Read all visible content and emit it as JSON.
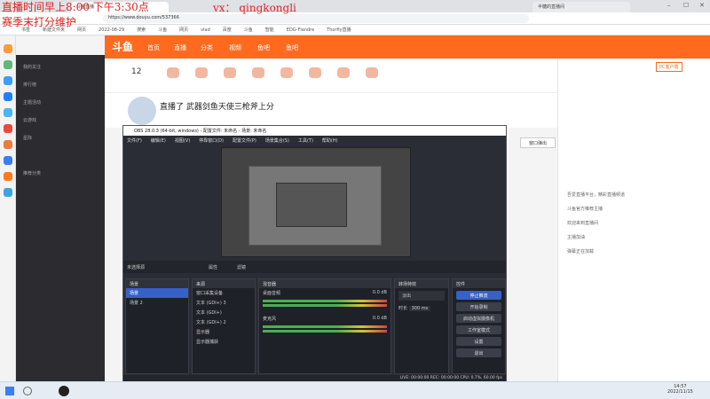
{
  "overlay": {
    "line1": "直播时间早上8:00 下午3:30点",
    "line2": "赛季末打分维护",
    "vx": "vx： qingkongli"
  },
  "browser": {
    "url": "https://www.douyu.com/537366",
    "tabs": [
      "斗鱼直播",
      "半糖的直播间"
    ],
    "bookmarks": [
      "书签",
      "新建文件夹",
      "网页",
      "2022-08-29",
      "搜索",
      "斗鱼",
      "网页",
      "vlad",
      "百度",
      "斗鱼",
      "智能",
      "EDG-Flandre",
      "Thorfly直播"
    ]
  },
  "douyu": {
    "logo": "斗鱼",
    "nav": [
      "首页",
      "直播",
      "分类",
      "视频",
      "鱼吧",
      "鱼吧"
    ],
    "sidebar": [
      "我的关注",
      "排行榜",
      "主题活动",
      "云游戏",
      "星际",
      "推荐分类"
    ],
    "follow_count": "12",
    "room_title": "直播了 武器剑鱼天使三枪斧上分",
    "chat": [
      "吾爱直播平台，精彩直播频道",
      "斗鱼官方推荐主播",
      "欢迎来到直播间",
      "主播加油",
      "弹幕正在加载"
    ],
    "float_button": "窗口弹出",
    "pc_badge": "PC客户端"
  },
  "obs": {
    "title": "OBS 28.0.3 (64-bit, windows) - 配置文件: 未命名 - 场景: 未命名",
    "menu": [
      "文件(F)",
      "编辑(E)",
      "视图(V)",
      "停靠窗口(D)",
      "配置文件(P)",
      "场景集合(S)",
      "工具(T)",
      "帮助(H)"
    ],
    "no_source": "未选择源",
    "props": "属性",
    "filters": "滤镜",
    "scenes_hdr": "场景",
    "scenes": [
      "场景",
      "场景 2"
    ],
    "sources_hdr": "来源",
    "sources": [
      "窗口采集设备",
      "文本 (GDI+) 3",
      "文本 (GDI+)",
      "文本 (GDI+) 2",
      "显示器",
      "显示器捕获"
    ],
    "mixer_hdr": "混音器",
    "mixer": [
      {
        "name": "桌面音频",
        "db": "0.0 dB"
      },
      {
        "name": "麦克风",
        "db": "0.0 dB"
      }
    ],
    "transition_hdr": "转场特效",
    "transition_value": "淡出",
    "duration_label": "时长",
    "duration_value": "300 ms",
    "controls_hdr": "控件",
    "controls": [
      "停止推流",
      "开始录制",
      "启动虚拟摄像机",
      "工作室模式",
      "设置",
      "退出"
    ],
    "status": "LIVE: 00:00:00   REC: 00:00:00   CPU: 0.7%, 60.00 fps"
  },
  "taskbar": {
    "time": "14:57",
    "date": "2022/11/15"
  },
  "colors": {
    "douyu_orange": "#ff6a1f",
    "obs_bg": "#2a2d36",
    "obs_primary": "#3760c8",
    "overlay_red": "#dd2222"
  }
}
